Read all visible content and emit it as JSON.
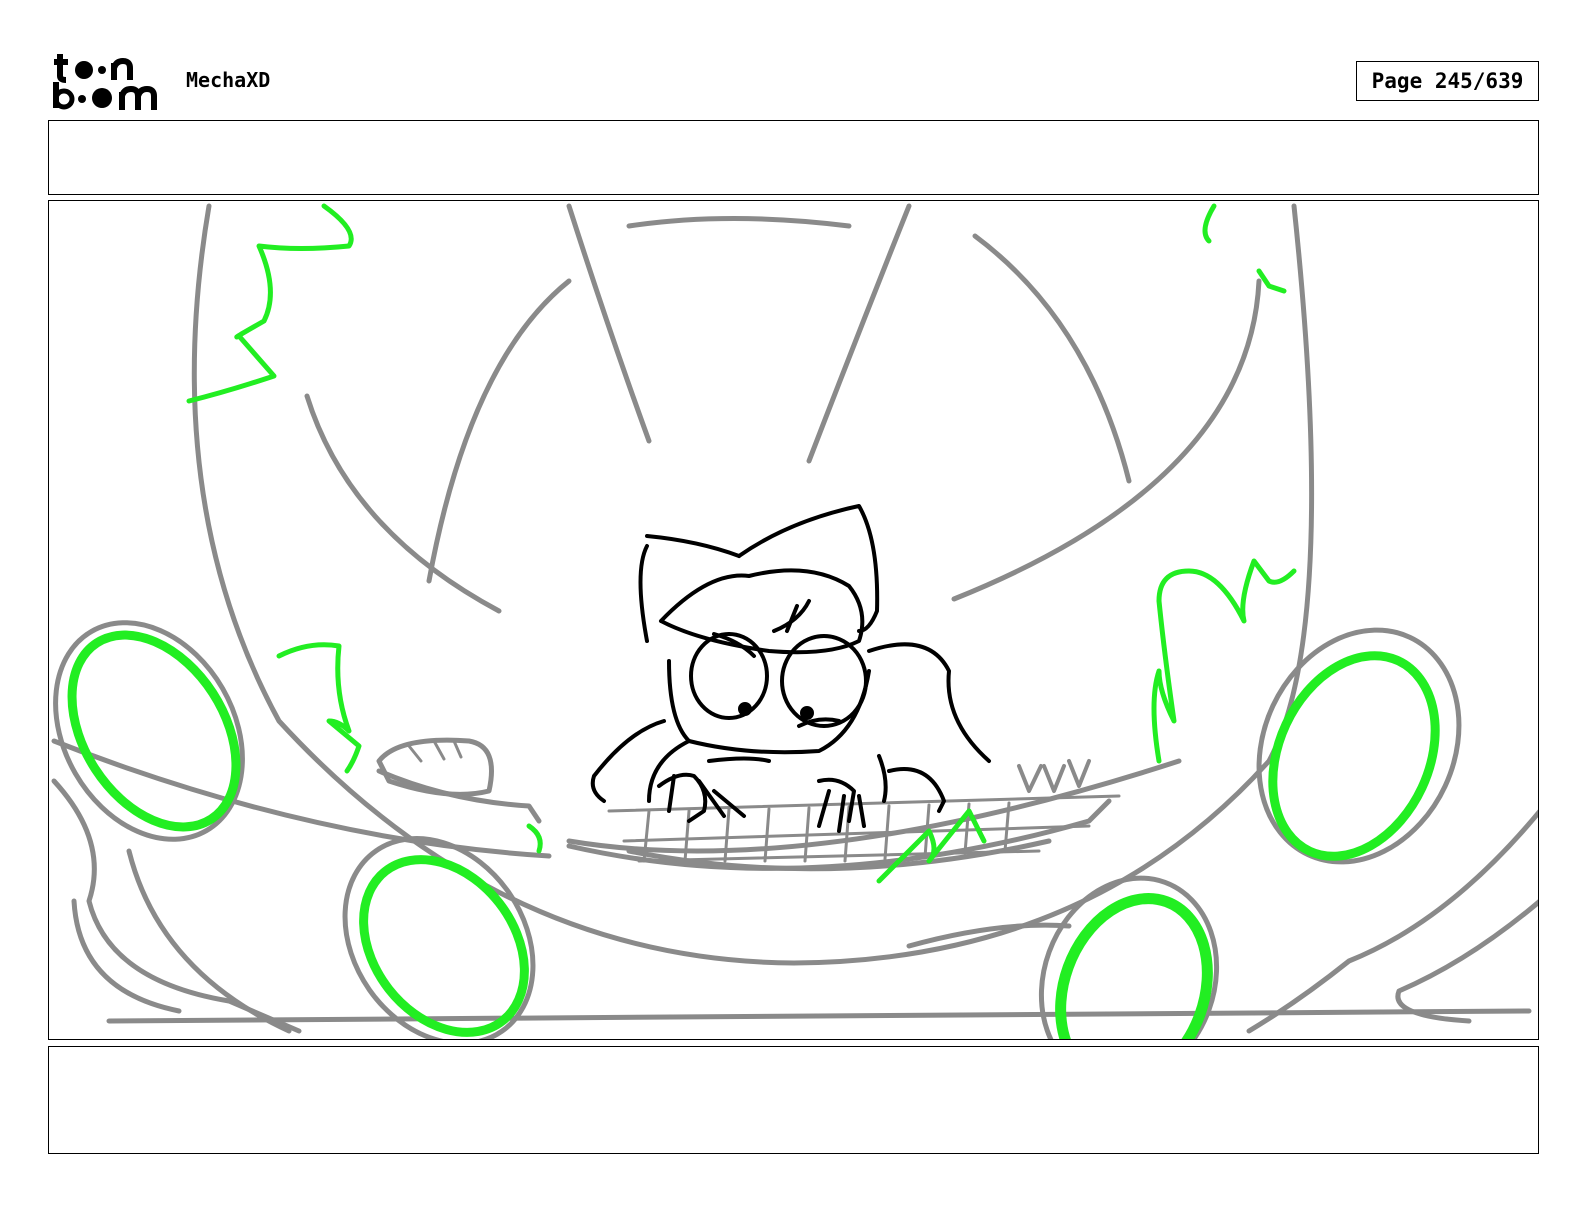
{
  "header": {
    "logo_text": "toon boom",
    "project_name": "MechaXD",
    "page_label": "Page 245/639"
  },
  "panel": {
    "action_notes": "",
    "dialogue_notes": ""
  },
  "colors": {
    "sketch_gray": "#8a8a8a",
    "sketch_black": "#000000",
    "energy_green": "#22ee22"
  }
}
